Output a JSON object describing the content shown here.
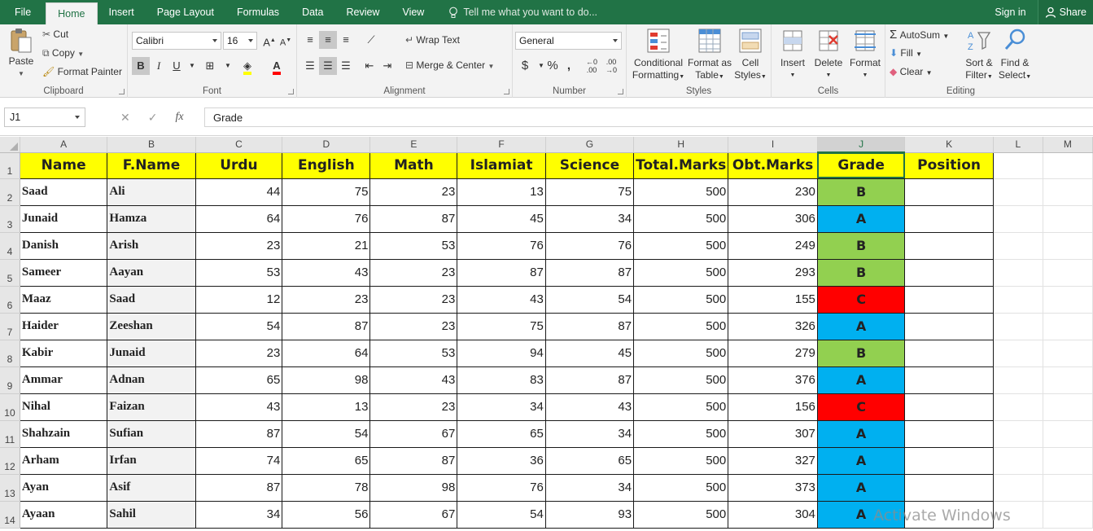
{
  "tabs": {
    "file": "File",
    "home": "Home",
    "insert": "Insert",
    "page_layout": "Page Layout",
    "formulas": "Formulas",
    "data": "Data",
    "review": "Review",
    "view": "View",
    "tell_me": "Tell me what you want to do...",
    "sign_in": "Sign in",
    "share": "Share"
  },
  "ribbon": {
    "clipboard": {
      "label": "Clipboard",
      "paste": "Paste",
      "cut": "Cut",
      "copy": "Copy",
      "format_painter": "Format Painter"
    },
    "font": {
      "label": "Font",
      "family": "Calibri",
      "size": "16",
      "bold": "B",
      "italic": "I",
      "underline": "U"
    },
    "alignment": {
      "label": "Alignment",
      "wrap_text": "Wrap Text",
      "merge_center": "Merge & Center"
    },
    "number": {
      "label": "Number",
      "format": "General",
      "currency": "$",
      "percent": "%",
      "comma": ","
    },
    "styles": {
      "label": "Styles",
      "conditional_formatting_1": "Conditional",
      "conditional_formatting_2": "Formatting",
      "format_as_table_1": "Format as",
      "format_as_table_2": "Table",
      "cell_styles_1": "Cell",
      "cell_styles_2": "Styles"
    },
    "cells": {
      "label": "Cells",
      "insert": "Insert",
      "delete": "Delete",
      "format": "Format"
    },
    "editing": {
      "label": "Editing",
      "autosum": "AutoSum",
      "fill": "Fill",
      "clear": "Clear",
      "sort_filter_1": "Sort &",
      "sort_filter_2": "Filter",
      "find_select_1": "Find &",
      "find_select_2": "Select"
    }
  },
  "formula_bar": {
    "name_box": "J1",
    "fx": "fx",
    "content": "Grade"
  },
  "columns": [
    "A",
    "B",
    "C",
    "D",
    "E",
    "F",
    "G",
    "H",
    "I",
    "J",
    "K",
    "L",
    "M"
  ],
  "selected_column": "J",
  "headers": [
    "Name",
    "F.Name",
    "Urdu",
    "English",
    "Math",
    "Islamiat",
    "Science",
    "Total.Marks",
    "Obt.Marks",
    "Grade",
    "Position"
  ],
  "rows": [
    {
      "num": "1"
    },
    {
      "num": "2",
      "cells": [
        "Saad",
        "Ali",
        "44",
        "75",
        "23",
        "13",
        "75",
        "500",
        "230",
        "B"
      ]
    },
    {
      "num": "3",
      "cells": [
        "Junaid",
        "Hamza",
        "64",
        "76",
        "87",
        "45",
        "34",
        "500",
        "306",
        "A"
      ]
    },
    {
      "num": "4",
      "cells": [
        "Danish",
        "Arish",
        "23",
        "21",
        "53",
        "76",
        "76",
        "500",
        "249",
        "B"
      ]
    },
    {
      "num": "5",
      "cells": [
        "Sameer",
        "Aayan",
        "53",
        "43",
        "23",
        "87",
        "87",
        "500",
        "293",
        "B"
      ]
    },
    {
      "num": "6",
      "cells": [
        "Maaz",
        "Saad",
        "12",
        "23",
        "23",
        "43",
        "54",
        "500",
        "155",
        "C"
      ]
    },
    {
      "num": "7",
      "cells": [
        "Haider",
        "Zeeshan",
        "54",
        "87",
        "23",
        "75",
        "87",
        "500",
        "326",
        "A"
      ]
    },
    {
      "num": "8",
      "cells": [
        "Kabir",
        "Junaid",
        "23",
        "64",
        "53",
        "94",
        "45",
        "500",
        "279",
        "B"
      ]
    },
    {
      "num": "9",
      "cells": [
        "Ammar",
        "Adnan",
        "65",
        "98",
        "43",
        "83",
        "87",
        "500",
        "376",
        "A"
      ]
    },
    {
      "num": "10",
      "cells": [
        "Nihal",
        "Faizan",
        "43",
        "13",
        "23",
        "34",
        "43",
        "500",
        "156",
        "C"
      ]
    },
    {
      "num": "11",
      "cells": [
        "Shahzain",
        "Sufian",
        "87",
        "54",
        "67",
        "65",
        "34",
        "500",
        "307",
        "A"
      ]
    },
    {
      "num": "12",
      "cells": [
        "Arham",
        "Irfan",
        "74",
        "65",
        "87",
        "36",
        "65",
        "500",
        "327",
        "A"
      ]
    },
    {
      "num": "13",
      "cells": [
        "Ayan",
        "Asif",
        "87",
        "78",
        "98",
        "76",
        "34",
        "500",
        "373",
        "A"
      ]
    },
    {
      "num": "14",
      "cells": [
        "Ayaan",
        "Sahil",
        "34",
        "56",
        "67",
        "54",
        "93",
        "500",
        "304",
        "A"
      ]
    }
  ],
  "grade_colors": {
    "A": "#00b0f0",
    "B": "#92d050",
    "C": "#ff0000"
  },
  "header_fill": "#ffff00",
  "watermark": "Activate Windows"
}
